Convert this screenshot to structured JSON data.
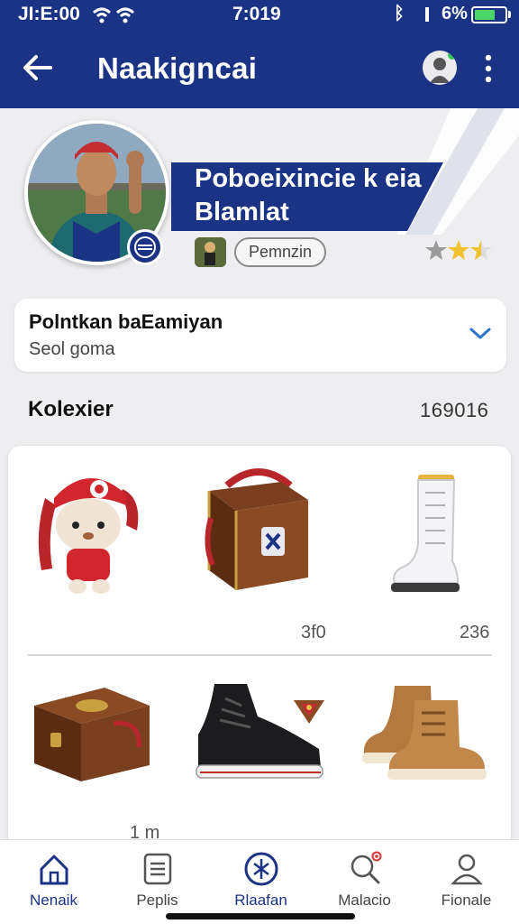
{
  "status_bar": {
    "time_left": "JI:E:00",
    "time_center": "7:019",
    "battery": "6%"
  },
  "header": {
    "title": "Naakigncai",
    "back_icon": "arrow-left-icon",
    "more_icon": "more-vertical-icon"
  },
  "profile": {
    "name_line1": "Poboeixincie k eia",
    "name_line2": "Blamlat",
    "role": "Pemnzin",
    "rating": 2.5,
    "rating_max": 3,
    "colors": {
      "primary": "#1b3384",
      "star": "#f2c12e"
    }
  },
  "selector": {
    "title": "Polntkan baEamiyan",
    "value": "Seol  goma"
  },
  "collection": {
    "title": "Kolexier",
    "count": "169016",
    "row1_prices": [
      "3f0",
      "236"
    ],
    "row2_note": "1 m",
    "items": [
      {
        "icon": "plush-doll-icon"
      },
      {
        "icon": "treasure-chest-icon"
      },
      {
        "icon": "white-boot-icon"
      },
      {
        "icon": "wooden-chest-icon"
      },
      {
        "icon": "black-sneaker-icon"
      },
      {
        "icon": "brown-boot-icon"
      }
    ]
  },
  "bottom_nav": {
    "items": [
      {
        "label": "Nenaik",
        "icon": "home-icon",
        "active": true
      },
      {
        "label": "Peplis",
        "icon": "list-icon",
        "active": false
      },
      {
        "label": "Rlaafan",
        "icon": "compass-icon",
        "active": false
      },
      {
        "label": "Malacio",
        "icon": "search-icon",
        "active": false
      },
      {
        "label": "Fionale",
        "icon": "profile-icon",
        "active": false
      }
    ]
  }
}
